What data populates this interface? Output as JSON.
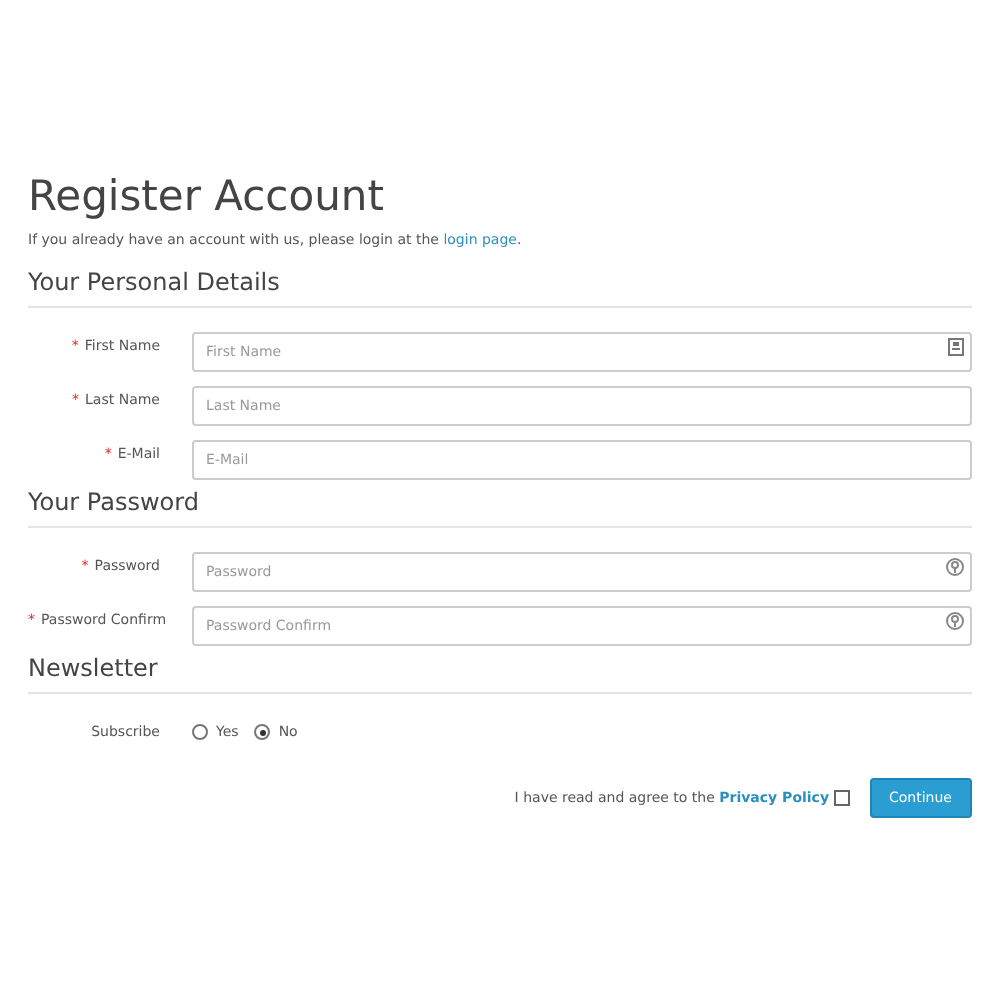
{
  "title": "Register Account",
  "required_mark": "*",
  "intro": {
    "text": "If you already have an account with us, please login at the ",
    "link": "login page",
    "end": "."
  },
  "sections": [
    {
      "heading": "Your Personal Details",
      "fields": [
        {
          "label": "First Name",
          "required": true,
          "placeholder": "First Name",
          "kind": "card"
        },
        {
          "label": "Last Name",
          "required": true,
          "placeholder": "Last Name",
          "kind": "plain"
        },
        {
          "label": "E-Mail",
          "required": true,
          "placeholder": "E-Mail",
          "kind": "plain"
        }
      ]
    },
    {
      "heading": "Your Password",
      "fields": [
        {
          "label": "Password",
          "required": true,
          "placeholder": "Password",
          "kind": "key"
        },
        {
          "label": "Password Confirm",
          "required": true,
          "placeholder": "Password Confirm",
          "kind": "key"
        }
      ]
    }
  ],
  "newsletter": {
    "heading": "Newsletter",
    "label": "Subscribe",
    "options": [
      {
        "label": "Yes",
        "selected": false
      },
      {
        "label": "No",
        "selected": true
      }
    ]
  },
  "agree": {
    "text": "I have read and agree to the ",
    "link": "Privacy Policy",
    "checked": false
  },
  "button": "Continue"
}
